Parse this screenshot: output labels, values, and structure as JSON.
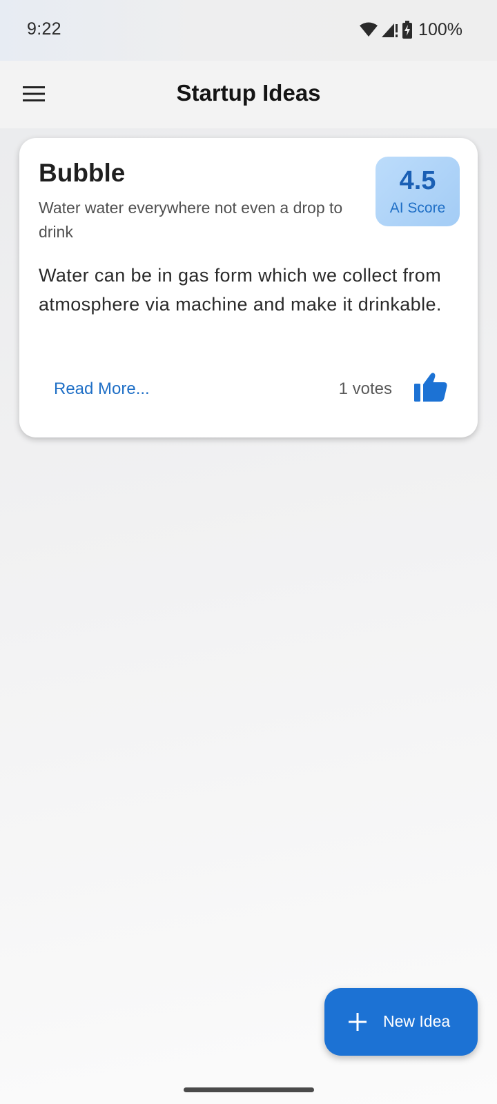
{
  "status_bar": {
    "time": "9:22",
    "battery": "100%",
    "icons": [
      "wifi-icon",
      "signal-icon",
      "battery-charging-icon"
    ]
  },
  "app_bar": {
    "title": "Startup Ideas",
    "menu_icon": "menu-icon"
  },
  "ideas": [
    {
      "title": "Bubble",
      "tagline": "Water water everywhere not even a drop to drink",
      "description": "Water can be in gas form which we collect from atmosphere via machine and make it drinkable.",
      "ai_score": "4.5",
      "ai_score_label": "AI Score",
      "read_more": "Read More...",
      "votes": "1 votes",
      "vote_icon": "thumb-up-icon"
    }
  ],
  "fab": {
    "label": "New Idea",
    "icon": "plus-icon"
  },
  "colors": {
    "accent": "#1c72d4",
    "score_badge": "#b3d6fa",
    "score_text": "#1a5fb4"
  }
}
